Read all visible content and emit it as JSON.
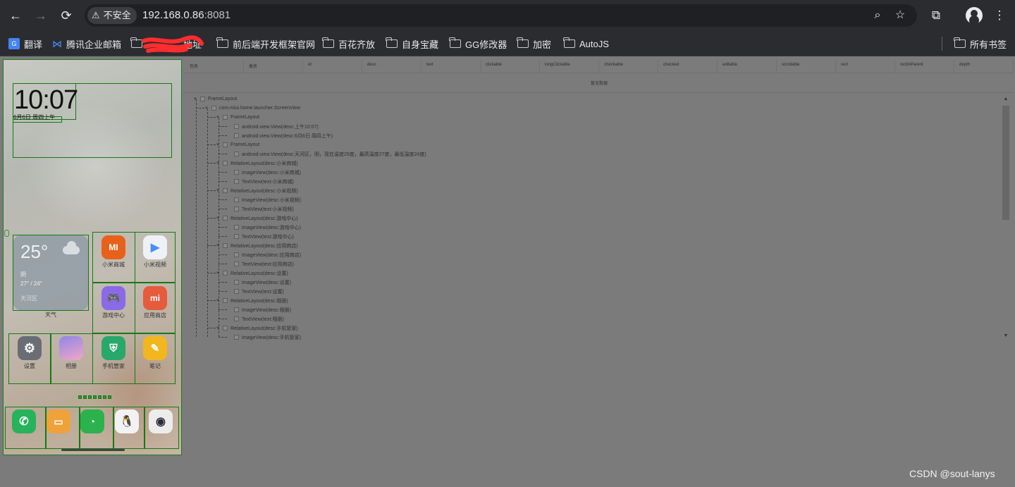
{
  "browser": {
    "security_label": "不安全",
    "url_host": "192.168.0.86",
    "url_port": ":8081",
    "back_icon": "←",
    "forward_icon": "→",
    "reload_icon": "⟳"
  },
  "bookmarks": {
    "items": [
      "翻译",
      "腾讯企业邮箱",
      "地址",
      "前后端开发框架官网",
      "百花齐放",
      "自身宝藏",
      "GG修改器",
      "加密",
      "AutoJS"
    ],
    "all_bookmarks": "所有书签"
  },
  "phone": {
    "clock": "10:07",
    "date": "6月6日 周四上午",
    "weather": {
      "temp": "25°",
      "condition": "阴",
      "range": "27° / 24°",
      "location": "天河区",
      "label": "天气"
    },
    "apps": [
      "小米商城",
      "小米视频",
      "游戏中心",
      "应用商店",
      "设置",
      "相册",
      "手机管家",
      "笔记"
    ]
  },
  "table": {
    "headers": [
      "包名",
      "类名",
      "id",
      "desc",
      "text",
      "clickable",
      "longClickable",
      "checkable",
      "checked",
      "editable",
      "scrollable",
      "rect",
      "rectInParent",
      "depth"
    ],
    "empty_text": "暂无数据"
  },
  "tree": [
    {
      "depth": 0,
      "label": "FrameLayout"
    },
    {
      "depth": 1,
      "label": "com.miui.home.launcher.ScreenView"
    },
    {
      "depth": 2,
      "label": "FrameLayout"
    },
    {
      "depth": 3,
      "label": "android.view.View(desc:上午10:07)"
    },
    {
      "depth": 3,
      "label": "android.view.View(desc:6月6日 周四上午)"
    },
    {
      "depth": 2,
      "label": "FrameLayout"
    },
    {
      "depth": 3,
      "label": "android.view.View(desc:天河区，阴，现在温度25度，最高温度27度，最低温度24度)"
    },
    {
      "depth": 2,
      "label": "RelativeLayout(desc:小米商城)"
    },
    {
      "depth": 3,
      "label": "ImageView(desc:小米商城)"
    },
    {
      "depth": 3,
      "label": "TextView(text:小米商城)"
    },
    {
      "depth": 2,
      "label": "RelativeLayout(desc:小米视频)"
    },
    {
      "depth": 3,
      "label": "ImageView(desc:小米视频)"
    },
    {
      "depth": 3,
      "label": "TextView(text:小米视频)"
    },
    {
      "depth": 2,
      "label": "RelativeLayout(desc:游戏中心)"
    },
    {
      "depth": 3,
      "label": "ImageView(desc:游戏中心)"
    },
    {
      "depth": 3,
      "label": "TextView(text:游戏中心)"
    },
    {
      "depth": 2,
      "label": "RelativeLayout(desc:应用商店)"
    },
    {
      "depth": 3,
      "label": "ImageView(desc:应用商店)"
    },
    {
      "depth": 3,
      "label": "TextView(text:应用商店)"
    },
    {
      "depth": 2,
      "label": "RelativeLayout(desc:设置)"
    },
    {
      "depth": 3,
      "label": "ImageView(desc:设置)"
    },
    {
      "depth": 3,
      "label": "TextView(text:设置)"
    },
    {
      "depth": 2,
      "label": "RelativeLayout(desc:相册)"
    },
    {
      "depth": 3,
      "label": "ImageView(desc:相册)"
    },
    {
      "depth": 3,
      "label": "TextView(text:相册)"
    },
    {
      "depth": 2,
      "label": "RelativeLayout(desc:手机管家)"
    },
    {
      "depth": 3,
      "label": "ImageView(desc:手机管家)"
    }
  ],
  "watermark": "CSDN @sout-lanys"
}
